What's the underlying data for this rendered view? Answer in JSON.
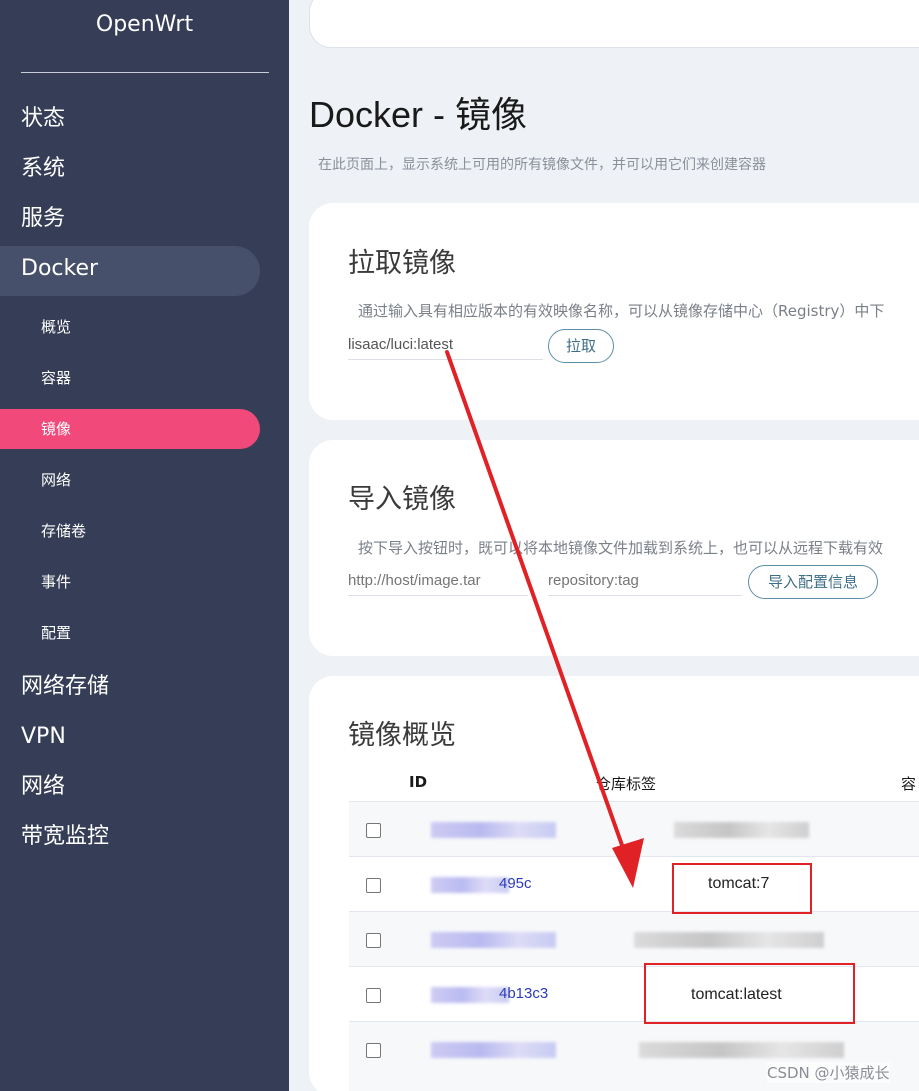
{
  "sidebar": {
    "brand": "OpenWrt",
    "top_items": [
      "状态",
      "系统",
      "服务",
      "Docker"
    ],
    "sub_items": [
      "概览",
      "容器",
      "镜像",
      "网络",
      "存储卷",
      "事件",
      "配置"
    ],
    "bottom_items": [
      "网络存储",
      "VPN",
      "网络",
      "带宽监控"
    ]
  },
  "page": {
    "title": "Docker - 镜像",
    "description": "在此页面上，显示系统上可用的所有镜像文件，并可以用它们来创建容器"
  },
  "pull": {
    "title": "拉取镜像",
    "description": "通过输入具有相应版本的有效映像名称，可以从镜像存储中心（Registry）中下",
    "input_value": "lisaac/luci:latest",
    "button": "拉取"
  },
  "import": {
    "title": "导入镜像",
    "description": "按下导入按钮时，既可以将本地镜像文件加载到系统上，也可以从远程下载有效",
    "url_placeholder": "http://host/image.tar",
    "repo_placeholder": "repository:tag",
    "button": "导入配置信息"
  },
  "overview": {
    "title": "镜像概览",
    "headers": {
      "id": "ID",
      "tags": "仓库标签",
      "containers": "容"
    },
    "rows": [
      {
        "id_suffix": "",
        "tag": ""
      },
      {
        "id_suffix": "495c",
        "tag": "tomcat:7"
      },
      {
        "id_suffix": "",
        "tag": ""
      },
      {
        "id_suffix": "4b13c3",
        "tag": "tomcat:latest"
      },
      {
        "id_suffix": "",
        "tag": ""
      }
    ]
  },
  "watermark": "CSDN @小猿成长",
  "colors": {
    "sidebar_bg": "#353e56",
    "active_sub_bg": "#f0497a",
    "highlight": "#e02226"
  }
}
